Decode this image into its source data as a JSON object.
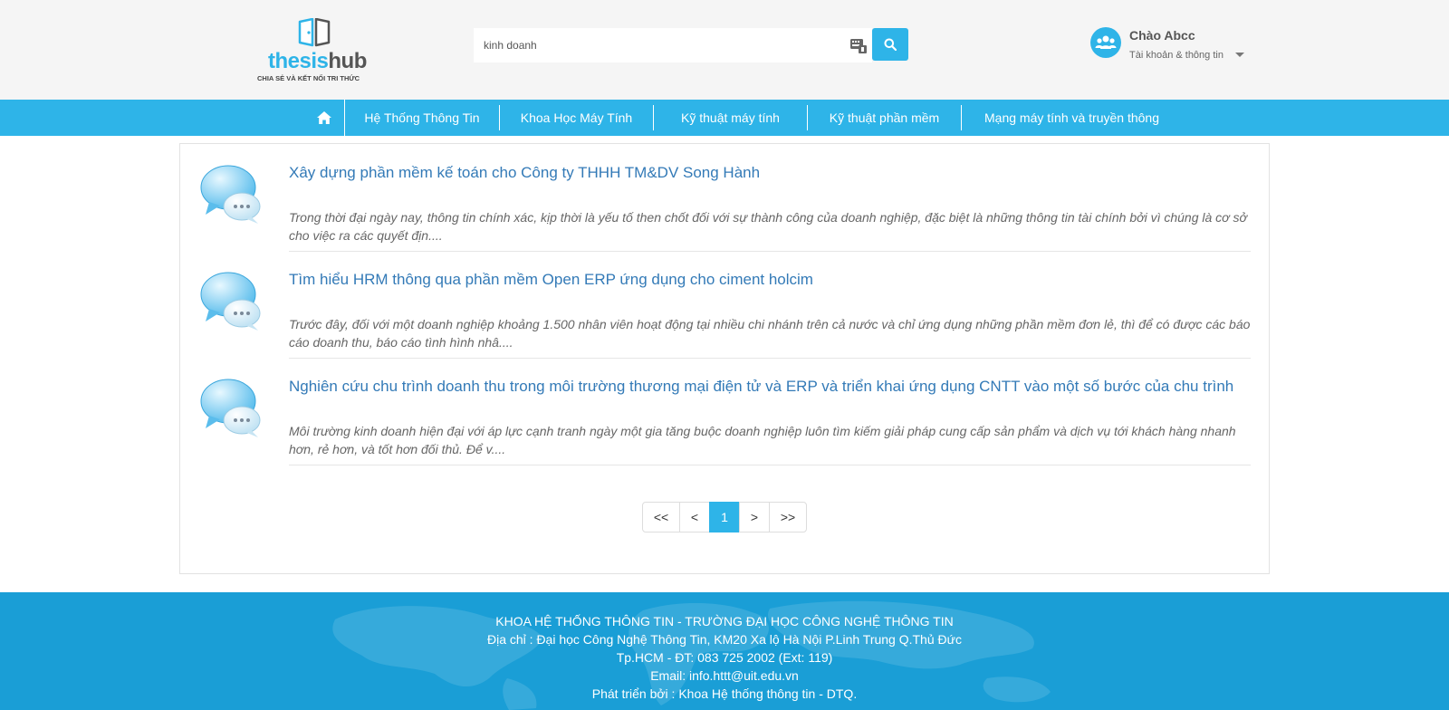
{
  "header": {
    "logo": {
      "brand_part1": "thesis",
      "brand_part2": "hub",
      "tagline": "CHIA SẺ VÀ KẾT NỐI TRI THỨC"
    },
    "search": {
      "value": "kinh doanh",
      "placeholder": ""
    },
    "user": {
      "greeting": "Chào Abcc",
      "account_label": "Tài khoản & thông tin"
    }
  },
  "nav": {
    "items": [
      {
        "label": "Hệ Thống Thông Tin"
      },
      {
        "label": "Khoa Học Máy Tính"
      },
      {
        "label": "Kỹ thuật máy tính"
      },
      {
        "label": "Kỹ thuật phần mềm"
      },
      {
        "label": "Mạng máy tính và truyền thông"
      }
    ]
  },
  "results": [
    {
      "title": "Xây dựng phần mềm kế toán cho Công ty THHH TM&DV Song Hành",
      "description": "Trong thời đại ngày nay, thông tin chính xác, kịp thời là yếu tố then chốt đối với sự thành công của doanh nghiệp, đặc biệt là những thông tin tài chính bởi vì chúng là cơ sở cho việc ra các quyết địn...."
    },
    {
      "title": "Tìm hiểu HRM thông qua phần mềm Open ERP ứng dụng cho ciment holcim",
      "description": "Trước đây, đối với một doanh nghiệp khoảng 1.500 nhân viên hoạt động tại nhiều chi nhánh trên cả nước và chỉ ứng dụng những phần mềm đơn lẻ, thì để có được các báo cáo doanh thu, báo cáo tình hình nhâ...."
    },
    {
      "title": "Nghiên cứu chu trình doanh thu trong môi trường thương mại điện tử và ERP và triển khai ứng dụng CNTT vào một số bước của chu trình",
      "description": "Môi trường kinh doanh hiện đại với áp lực cạnh tranh ngày một gia tăng buộc doanh nghiệp luôn tìm kiếm giải pháp cung cấp sản phẩm và dịch vụ tới khách hàng nhanh hơn, rẻ hơn, và tốt hơn đối thủ. Để v...."
    }
  ],
  "pagination": {
    "first": "<<",
    "prev": "<",
    "current": "1",
    "next": ">",
    "last": ">>"
  },
  "footer": {
    "line1": "KHOA HỆ THỐNG THÔNG TIN - TRƯỜNG ĐẠI HỌC CÔNG NGHỆ THÔNG TIN",
    "line2": "Địa chỉ : Đại học Công Nghệ Thông Tin, KM20 Xa lộ Hà Nội P.Linh Trung Q.Thủ Đức",
    "line3": "Tp.HCM - ĐT: 083 725 2002 (Ext: 119)",
    "line4": "Email: info.httt@uit.edu.vn",
    "line5": "Phát triển bởi : Khoa Hệ thống thông tin - DTQ."
  },
  "colors": {
    "brand": "#2eb4e8",
    "link": "#337ab7",
    "footer": "#1a9ed6"
  },
  "icons": [
    "book-icon",
    "keyboard-icon",
    "search-icon",
    "users-icon",
    "caret-down-icon",
    "home-icon",
    "chat-bubbles-icon"
  ]
}
